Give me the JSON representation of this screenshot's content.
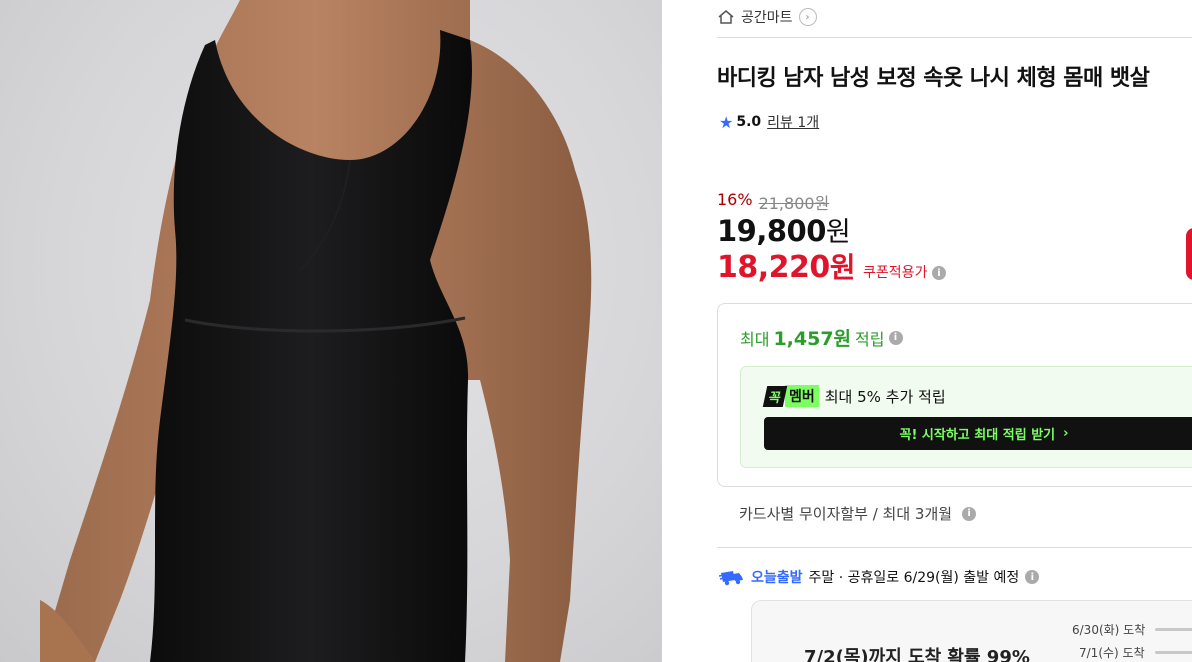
{
  "store": {
    "name": "공간마트"
  },
  "product": {
    "title": "바디킹 남자 남성 보정 속옷 나시 체형 몸매 뱃살",
    "rating": "5.0",
    "review_link": "리뷰 1개"
  },
  "price": {
    "discount_rate": "16%",
    "original": "21,800원",
    "sale_number": "19,800",
    "sale_unit": "원",
    "coupon_number": "18,220",
    "coupon_unit": "원",
    "coupon_label": "쿠폰적용가"
  },
  "reward": {
    "prefix": "최대",
    "amount": "1,457원",
    "suffix": "적립",
    "member_badge_left": "꼭",
    "member_badge_right": "멤버",
    "member_text": "최대 5% 추가 적립",
    "member_cta": "꼭! 시작하고 최대 적립 받기",
    "member_cta_chevron": "›"
  },
  "installment": {
    "text": "카드사별 무이자할부 / 최대 3개월"
  },
  "shipping": {
    "brand": "오늘출발",
    "note": "주말 · 공휴일로 6/29(월) 출발 예정",
    "arrival_main": "7/2(목)까지 도착 확률 99%",
    "arrivals": [
      "6/30(화) 도착",
      "7/1(수) 도착"
    ]
  },
  "icons": {
    "home": "home-icon",
    "chevron": "chevron-right-icon",
    "star": "star-icon",
    "info": "info-icon",
    "truck": "delivery-truck-icon"
  },
  "colors": {
    "accent_blue": "#346aff",
    "sale_red": "#e0152b",
    "reward_green": "#2a9d2a",
    "member_green": "#7cff63"
  }
}
